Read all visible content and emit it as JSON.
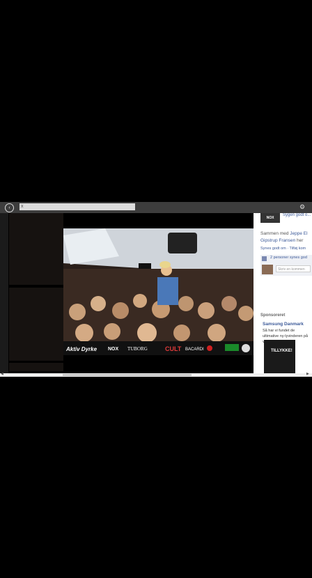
{
  "toolbar": {
    "back_icon": "back-arrow-icon",
    "url_close": "x",
    "settings_icon": "gear-icon"
  },
  "panel": {
    "page_logo": "NOX",
    "top_name": "Sygen godt o...",
    "with_prefix": "Sammen med ",
    "with_name": "Jeppe El",
    "with_name2": "Gipstrup Fransen",
    "with_suffix": " her",
    "like_actions": "Synes godt om · Tilføj kom",
    "likes_count": "2 personer synes god",
    "comment_placeholder": "Skriv en kommen",
    "sponsored_label": "Sponsoreret",
    "ad_title": "Samsung Danmark",
    "ad_text": "Så har vi fundet de ultimative ny-lyvinderen på vi",
    "ad_image_text": "TILLYKKE!"
  },
  "photo": {
    "brand_logos": [
      "NOX",
      "TUBORG",
      "CULT",
      "BACARDI"
    ],
    "colors": {
      "ceiling": "#cfd4da",
      "crowd": "#3a2a22"
    }
  }
}
